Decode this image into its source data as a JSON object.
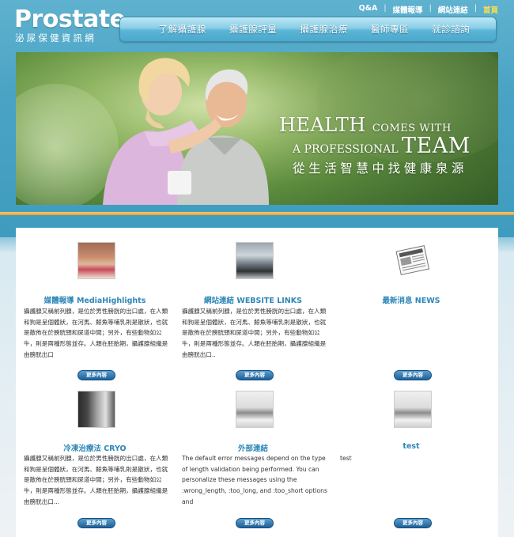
{
  "logo": {
    "brand": "Prostate",
    "subtitle": "泌尿保健資訊網"
  },
  "top_links": [
    {
      "label": "Q&A"
    },
    {
      "label": "媒體報導"
    },
    {
      "label": "網站連結"
    },
    {
      "label": "首頁"
    }
  ],
  "nav": [
    {
      "label": "了解攝護腺"
    },
    {
      "label": "攝護腺評量"
    },
    {
      "label": "攝護腺治療"
    },
    {
      "label": "醫師專區"
    },
    {
      "label": "就診諮詢"
    }
  ],
  "hero": {
    "line1_big": "HEALTH",
    "line1_small": "COMES WITH",
    "line2_small": "A PROFESSIONAL",
    "line2_big": "TEAM",
    "line3": "從生活智慧中找健康泉源"
  },
  "cards": [
    {
      "title": "媒體報導 MediaHighlights",
      "icon": "hotel-room-thumbnail",
      "text": "攝護腺又稱前列腺，是位於男性膀胱的出口處，在人類和狗是呈個體狀，在河馬、鯨魚等哺乳則是散狀，也就是散佈在於膀胱頸和尿道中間；另外，有些動物如公牛，則是兩種形態並存。人類在胚胎期，攝護腺組織是由膀胱出口",
      "more": "更多內容"
    },
    {
      "title": "網站連結 WEBSITE LINKS",
      "icon": "living-room-thumbnail",
      "text": "攝護腺又稱前列腺，是位於男性膀胱的出口處，在人類和狗是呈個體狀，在河馬、鯨魚等哺乳則是散狀，也就是散佈在於膀胱頸和尿道中間；另外，有些動物如公牛，則是兩種形態並存。人類在胚胎期，攝護腺組織是由膀胱出口..",
      "more": "更多內容"
    },
    {
      "title": "最新消息 NEWS",
      "icon": "newspaper-icon",
      "text": "",
      "more": "更多內容"
    },
    {
      "title": "冷凍治療法 CRYO",
      "icon": "kitchen-thumbnail",
      "text": "攝護腺又稱前列腺，是位於男性膀胱的出口處，在人類和狗是呈個體狀，在河馬、鯨魚等哺乳則是散狀，也就是散佈在於膀胱頸和尿道中間；另外，有些動物如公牛，則是兩種形態並存。人類在胚胎期，攝護腺組織是由膀胱出口...",
      "more": "更多內容"
    },
    {
      "title": "外部連結",
      "icon": "interior-thumbnail",
      "text": "The default error messages depend on the type of length validation being performed. You can personalize these messages using the :wrong_length, :too_long, and :too_short options and",
      "more": "更多內容"
    },
    {
      "title": "test",
      "icon": "interior-thumbnail",
      "text": "test",
      "more": "更多內容"
    }
  ],
  "colors": {
    "accent": "#2e87b8",
    "home_link": "#ffe14a",
    "divider": "#e9a33b"
  }
}
